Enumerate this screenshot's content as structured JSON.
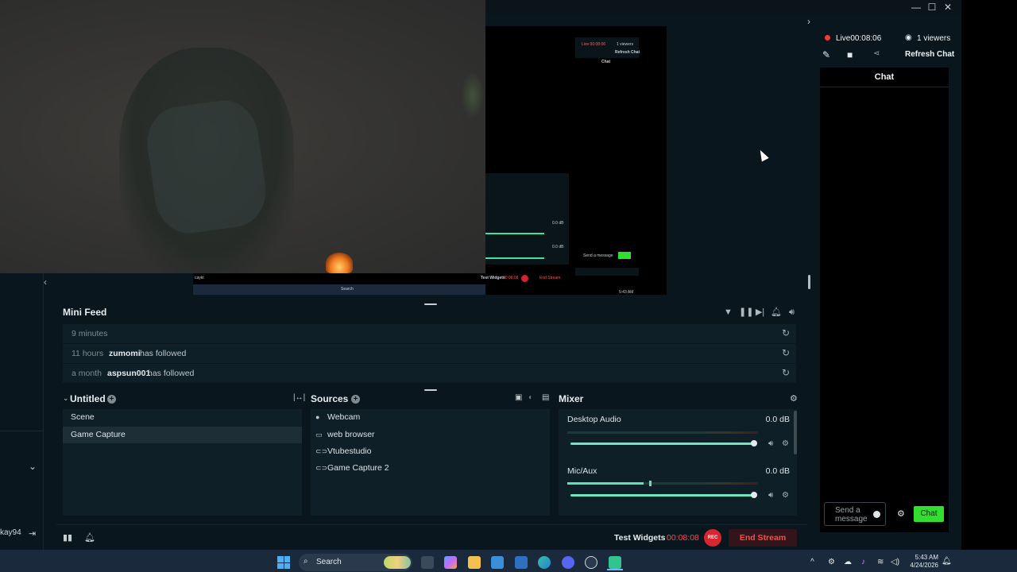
{
  "window": {
    "minimize": "—",
    "maximize": "☐",
    "close": "✕"
  },
  "left_nav": {
    "username": "kay94"
  },
  "mini_feed": {
    "title": "Mini Feed",
    "items": [
      {
        "time": "9 minutes",
        "user": "",
        "action": ""
      },
      {
        "time": "11 hours",
        "user": "zumomi",
        "action": "has followed"
      },
      {
        "time": "a month",
        "user": "aspsun001",
        "action": "has followed"
      }
    ]
  },
  "scenes": {
    "title": "Untitled",
    "items": [
      "Scene",
      "Game Capture"
    ],
    "selected": 1
  },
  "sources": {
    "title": "Sources",
    "items": [
      {
        "icon": "webcam-icon",
        "label": "Webcam"
      },
      {
        "icon": "monitor-icon",
        "label": "web browser"
      },
      {
        "icon": "gamepad-icon",
        "label": "Vtubestudio"
      },
      {
        "icon": "gamepad-icon",
        "label": "Game Capture 2"
      }
    ]
  },
  "mixer": {
    "title": "Mixer",
    "channels": [
      {
        "name": "Desktop Audio",
        "db": "0.0 dB",
        "level": 0.0,
        "volume": 1.0
      },
      {
        "name": "Mic/Aux",
        "db": "0.0 dB",
        "level": 0.4,
        "volume": 1.0
      }
    ]
  },
  "bottom_bar": {
    "test_widgets": "Test Widgets",
    "timer": "00:08:08",
    "rec": "REC",
    "end_stream": "End Stream"
  },
  "chat_panel": {
    "live_label": "Live",
    "live_time": "00:08:06",
    "viewers": "1 viewers",
    "refresh": "Refresh Chat",
    "chat_title": "Chat",
    "send_placeholder": "Send a message",
    "chat_button": "Chat"
  },
  "preview_inner": {
    "live": "Live 00:08:06",
    "viewers": "1 viewers",
    "refresh": "Refresh Chat",
    "chat": "Chat",
    "test_widgets": "Test Widgets",
    "timer": "00:08:08",
    "end_stream": "End Stream",
    "send": "Send a message",
    "chat_btn": "Chat",
    "search": "Search",
    "db1": "0.0 dB",
    "db2": "0.0 dB",
    "user": "caykt",
    "clock_time": "5:43 AM",
    "clock_date": "4/24/2026"
  },
  "taskbar": {
    "search": "Search",
    "time": "5:43 AM",
    "date": "4/24/2026"
  },
  "colors": {
    "accent": "#31e02f",
    "live": "#ee3a3a",
    "meter": "#5fe1b6",
    "background": "#09161d"
  }
}
